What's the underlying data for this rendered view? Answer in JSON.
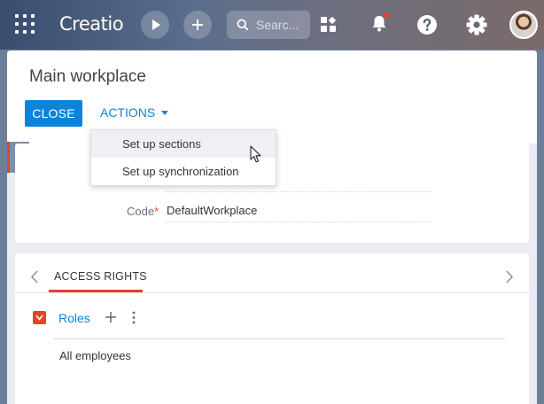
{
  "topbar": {
    "logo_text": "Creatio",
    "search_placeholder": "Searc...",
    "icons": [
      "apps-grid-icon",
      "play-icon",
      "plus-icon",
      "search-icon",
      "dashboard-icon",
      "bell-icon",
      "help-icon",
      "gear-icon",
      "avatar"
    ],
    "notification_dot_color": "#e2432c"
  },
  "page": {
    "title": "Main workplace",
    "close_label": "CLOSE",
    "actions_label": "ACTIONS"
  },
  "actions_menu": {
    "items": [
      "Set up sections",
      "Set up synchronization"
    ],
    "hovered_index": 0
  },
  "form": {
    "code_label": "Code",
    "required_mark": "*",
    "code_value": "DefaultWorkplace"
  },
  "tabs": {
    "active_tab": "ACCESS RIGHTS"
  },
  "roles": {
    "label": "Roles",
    "items": [
      "All employees"
    ]
  },
  "colors": {
    "accent_blue": "#0d84d9",
    "accent_red": "#e2432c"
  }
}
